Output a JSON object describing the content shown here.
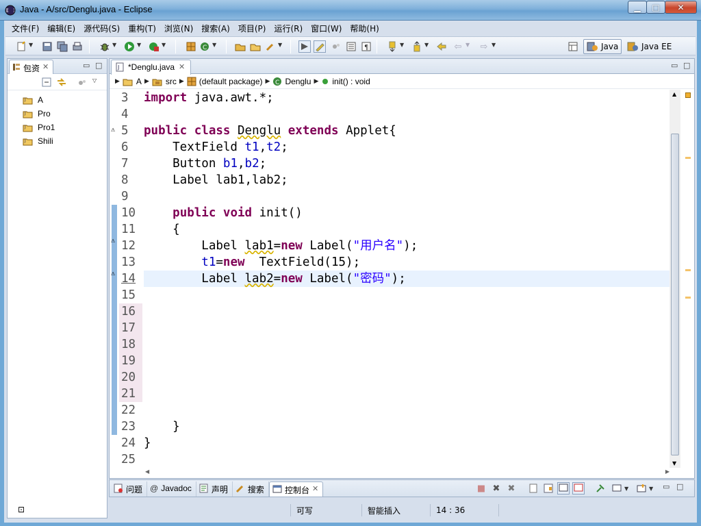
{
  "window": {
    "title": "Java  -  A/src/Denglu.java  -  Eclipse",
    "minimize": "▁",
    "maximize": "□",
    "close": "✕"
  },
  "menu": [
    "文件(F)",
    "编辑(E)",
    "源代码(S)",
    "重构(T)",
    "浏览(N)",
    "搜索(A)",
    "项目(P)",
    "运行(R)",
    "窗口(W)",
    "帮助(H)"
  ],
  "perspectives": {
    "java": "Java",
    "javaee": "Java EE"
  },
  "package_explorer": {
    "tab_label": "包资",
    "projects": [
      "A",
      "Pro",
      "Pro1",
      "Shili"
    ]
  },
  "editor": {
    "tab_label": "*Denglu.java",
    "breadcrumb": [
      "A",
      "src",
      "(default package)",
      "Denglu",
      "init() : void"
    ],
    "line_numbers": [
      "3",
      "4",
      "5",
      "6",
      "7",
      "8",
      "9",
      "10",
      "11",
      "12",
      "13",
      "14",
      "15",
      "16",
      "17",
      "18",
      "19",
      "20",
      "21",
      "22",
      "23",
      "24",
      "25"
    ],
    "lines": [
      "import java.awt.*;",
      "",
      "public class Denglu extends Applet{",
      "    TextField t1,t2;",
      "    Button b1,b2;",
      "    Label lab1,lab2;",
      "",
      "    public void init()",
      "    {",
      "        Label lab1=new Label(\"用户名\");",
      "        t1=new  TextField(15);",
      "        Label lab2=new Label(\"密码\");",
      "",
      "",
      "",
      "",
      "",
      "",
      "",
      "",
      "    }",
      "}",
      ""
    ]
  },
  "bottom_tabs": [
    "问题",
    "Javadoc",
    "声明",
    "搜索",
    "控制台"
  ],
  "status": {
    "writable": "可写",
    "insert_mode": "智能插入",
    "position": "14 : 36"
  },
  "colors": {
    "keyword": "#7f0055",
    "field": "#0000c0",
    "string": "#2a00ff",
    "current_line": "#e8f2fe"
  }
}
